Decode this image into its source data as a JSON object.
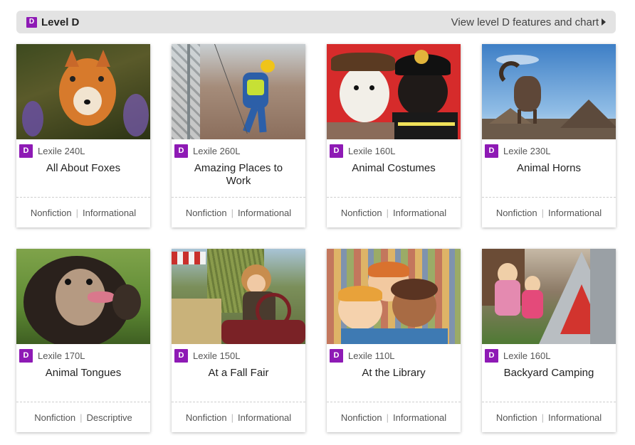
{
  "header": {
    "badge": "D",
    "title": "Level D",
    "link_text": "View level D features and chart"
  },
  "books": [
    {
      "badge": "D",
      "lexile": "Lexile 240L",
      "title": "All About Foxes",
      "genre": "Nonfiction",
      "type": "Informational"
    },
    {
      "badge": "D",
      "lexile": "Lexile 260L",
      "title": "Amazing Places to Work",
      "genre": "Nonfiction",
      "type": "Informational"
    },
    {
      "badge": "D",
      "lexile": "Lexile 160L",
      "title": "Animal Costumes",
      "genre": "Nonfiction",
      "type": "Informational"
    },
    {
      "badge": "D",
      "lexile": "Lexile 230L",
      "title": "Animal Horns",
      "genre": "Nonfiction",
      "type": "Informational"
    },
    {
      "badge": "D",
      "lexile": "Lexile 170L",
      "title": "Animal Tongues",
      "genre": "Nonfiction",
      "type": "Descriptive"
    },
    {
      "badge": "D",
      "lexile": "Lexile 150L",
      "title": "At a Fall Fair",
      "genre": "Nonfiction",
      "type": "Informational"
    },
    {
      "badge": "D",
      "lexile": "Lexile 110L",
      "title": "At the Library",
      "genre": "Nonfiction",
      "type": "Informational"
    },
    {
      "badge": "D",
      "lexile": "Lexile 160L",
      "title": "Backyard Camping",
      "genre": "Nonfiction",
      "type": "Informational"
    }
  ],
  "colors": {
    "badge": "#8e1ab5",
    "header_bg": "#e3e3e3"
  }
}
